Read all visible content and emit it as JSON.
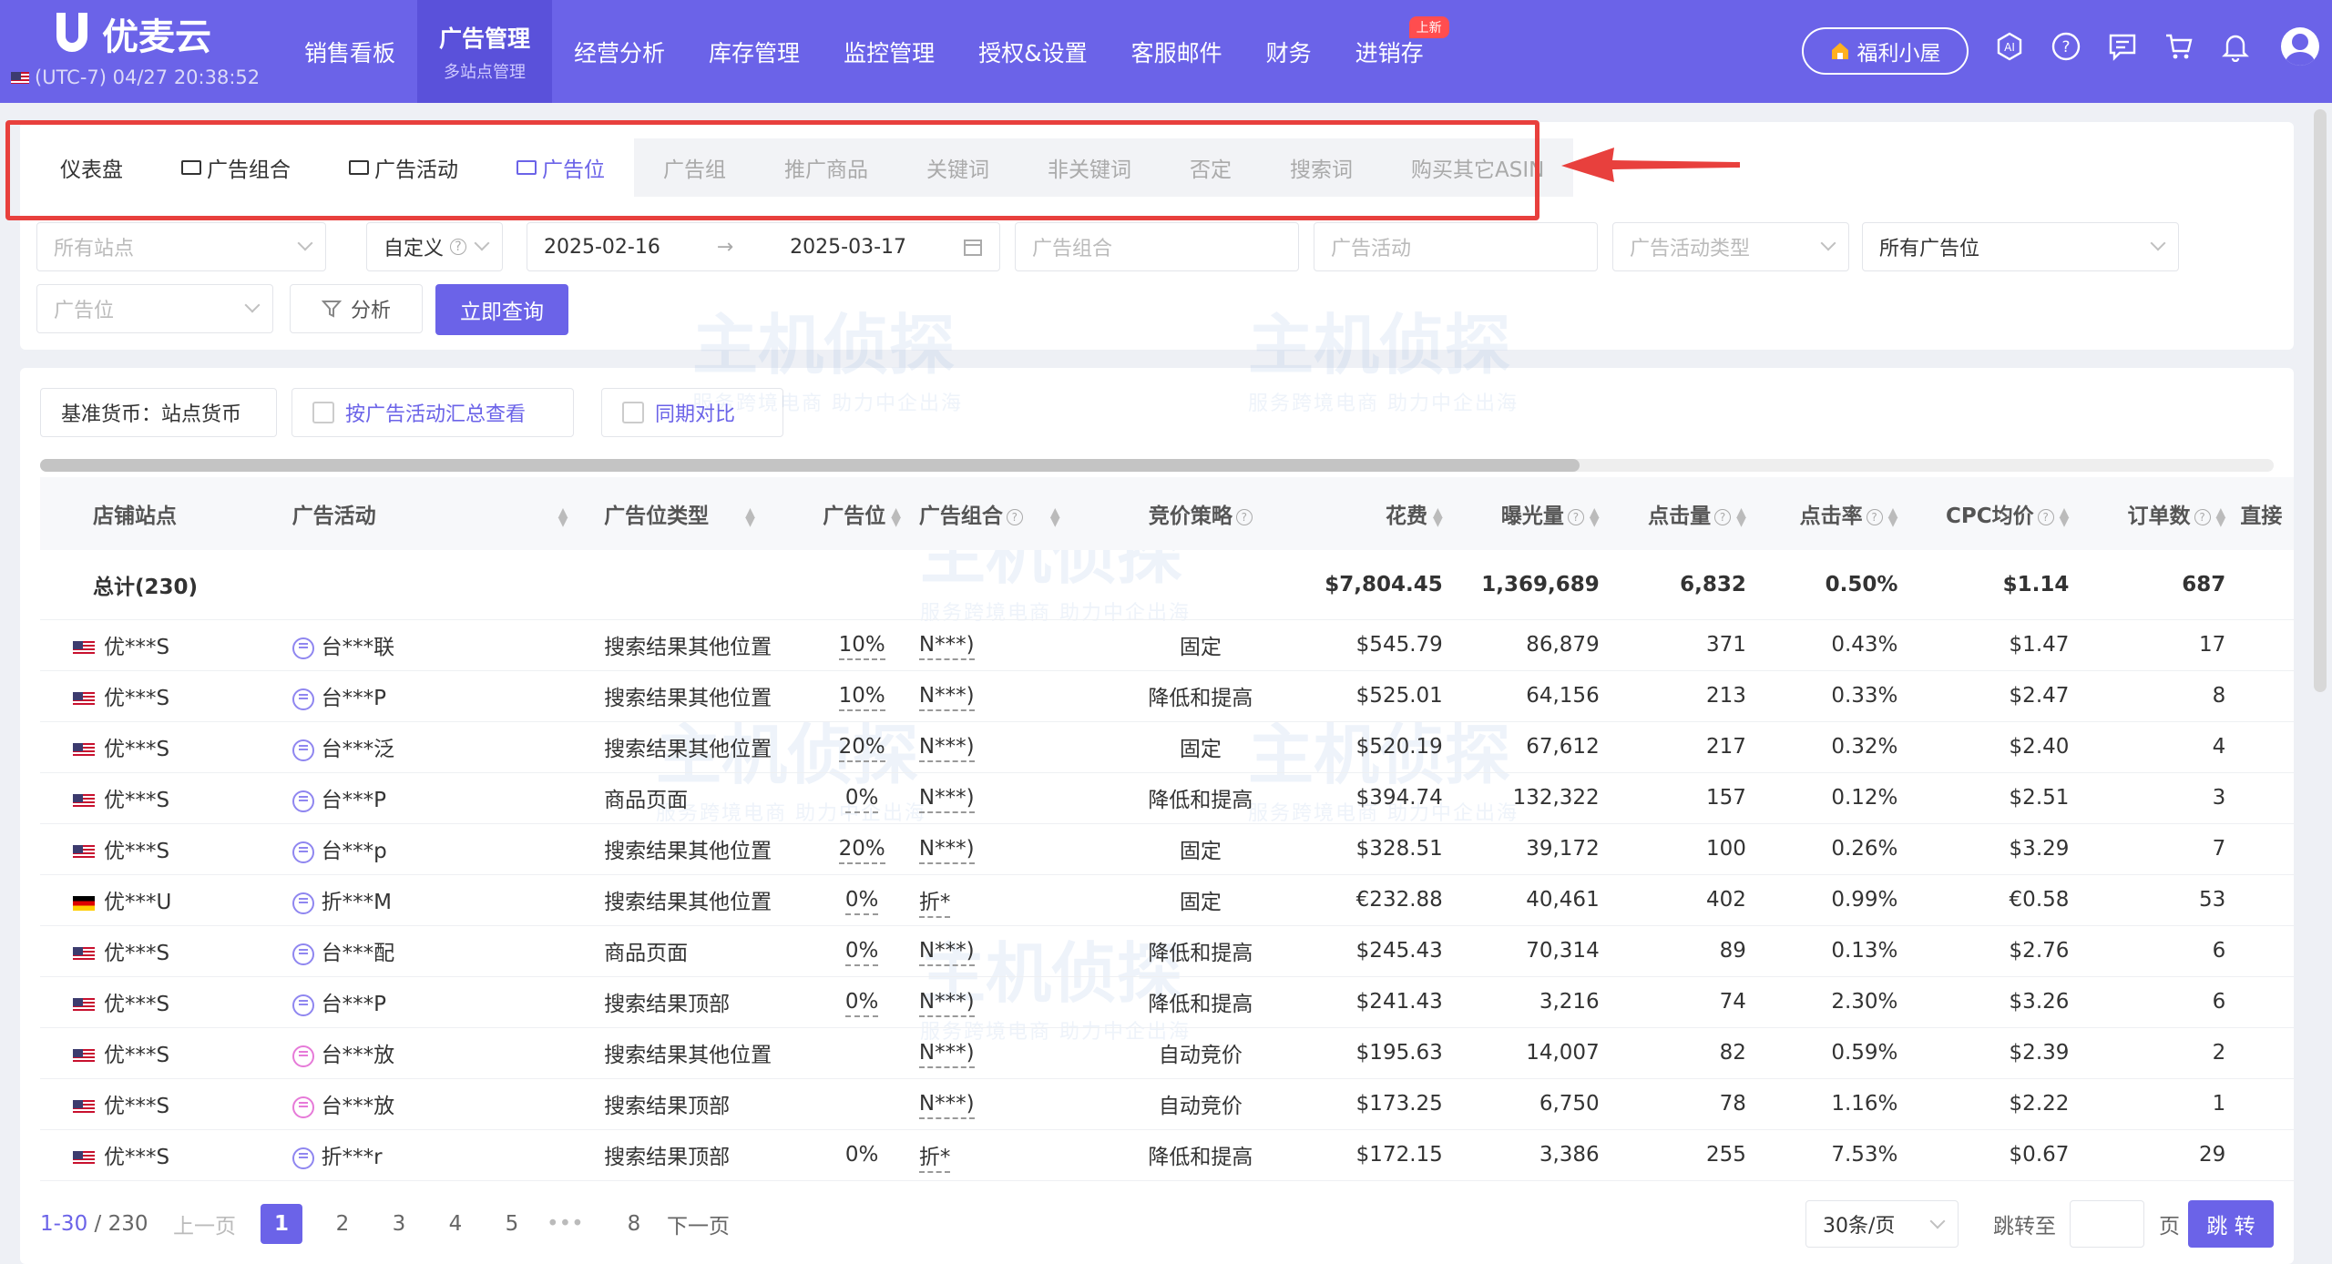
{
  "brand": {
    "name": "优麦云",
    "tz": "(UTC-7) 04/27 20:38:52"
  },
  "nav": [
    {
      "label": "销售看板",
      "sub": ""
    },
    {
      "label": "广告管理",
      "sub": "多站点管理"
    },
    {
      "label": "经营分析",
      "sub": ""
    },
    {
      "label": "库存管理",
      "sub": ""
    },
    {
      "label": "监控管理",
      "sub": ""
    },
    {
      "label": "授权&设置",
      "sub": ""
    },
    {
      "label": "客服邮件",
      "sub": ""
    },
    {
      "label": "财务",
      "sub": ""
    },
    {
      "label": "进销存",
      "sub": "",
      "badge": "上新"
    }
  ],
  "welfare": "福利小屋",
  "tabs": [
    "仪表盘",
    "广告组合",
    "广告活动",
    "广告位",
    "广告组",
    "推广商品",
    "关键词",
    "非关键词",
    "否定",
    "搜索词",
    "购买其它ASIN"
  ],
  "filters": {
    "site": "所有站点",
    "date_mode": "自定义",
    "date_start": "2025-02-16",
    "date_sep": "→",
    "date_end": "2025-03-17",
    "portfolio": "广告组合",
    "campaign": "广告活动",
    "campaign_type": "广告活动类型",
    "placement_all": "所有广告位",
    "placement": "广告位",
    "analyze": "分析",
    "query": "立即查询"
  },
  "options": {
    "currency": "基准货币：站点货币",
    "by_campaign": "按广告活动汇总查看",
    "yoy": "同期对比"
  },
  "columns": [
    "店铺站点",
    "广告活动",
    "广告位类型",
    "广告位",
    "广告组合",
    "竞价策略",
    "花费",
    "曝光量",
    "点击量",
    "点击率",
    "CPC均价",
    "订单数",
    "直接"
  ],
  "total": {
    "label": "总计(230)",
    "spend": "$7,804.45",
    "impressions": "1,369,689",
    "clicks": "6,832",
    "ctr": "0.50%",
    "cpc": "$1.14",
    "orders": "687"
  },
  "rows": [
    {
      "flag": "us",
      "shop": "优***S",
      "campaign": "台***联",
      "type": "搜索结果其他位置",
      "placement": "10%",
      "portfolio": "N***)",
      "strategy": "固定",
      "spend": "$545.79",
      "impressions": "86,879",
      "clicks": "371",
      "ctr": "0.43%",
      "cpc": "$1.47",
      "orders": "17"
    },
    {
      "flag": "us",
      "shop": "优***S",
      "campaign": "台***P",
      "type": "搜索结果其他位置",
      "placement": "10%",
      "portfolio": "N***)",
      "strategy": "降低和提高",
      "spend": "$525.01",
      "impressions": "64,156",
      "clicks": "213",
      "ctr": "0.33%",
      "cpc": "$2.47",
      "orders": "8"
    },
    {
      "flag": "us",
      "shop": "优***S",
      "campaign": "台***泛",
      "type": "搜索结果其他位置",
      "placement": "20%",
      "portfolio": "N***)",
      "strategy": "固定",
      "spend": "$520.19",
      "impressions": "67,612",
      "clicks": "217",
      "ctr": "0.32%",
      "cpc": "$2.40",
      "orders": "4"
    },
    {
      "flag": "us",
      "shop": "优***S",
      "campaign": "台***P",
      "type": "商品页面",
      "placement": "0%",
      "portfolio": "N***)",
      "strategy": "降低和提高",
      "spend": "$394.74",
      "impressions": "132,322",
      "clicks": "157",
      "ctr": "0.12%",
      "cpc": "$2.51",
      "orders": "3"
    },
    {
      "flag": "us",
      "shop": "优***S",
      "campaign": "台***p",
      "type": "搜索结果其他位置",
      "placement": "20%",
      "portfolio": "N***)",
      "strategy": "固定",
      "spend": "$328.51",
      "impressions": "39,172",
      "clicks": "100",
      "ctr": "0.26%",
      "cpc": "$3.29",
      "orders": "7"
    },
    {
      "flag": "de",
      "shop": "优***U",
      "campaign": "折***M",
      "type": "搜索结果其他位置",
      "placement": "0%",
      "portfolio": "折*",
      "strategy": "固定",
      "spend": "€232.88",
      "impressions": "40,461",
      "clicks": "402",
      "ctr": "0.99%",
      "cpc": "€0.58",
      "orders": "53"
    },
    {
      "flag": "us",
      "shop": "优***S",
      "campaign": "台***配",
      "type": "商品页面",
      "placement": "0%",
      "portfolio": "N***)",
      "strategy": "降低和提高",
      "spend": "$245.43",
      "impressions": "70,314",
      "clicks": "89",
      "ctr": "0.13%",
      "cpc": "$2.76",
      "orders": "6"
    },
    {
      "flag": "us",
      "shop": "优***S",
      "campaign": "台***P",
      "type": "搜索结果顶部",
      "placement": "0%",
      "portfolio": "N***)",
      "strategy": "降低和提高",
      "spend": "$241.43",
      "impressions": "3,216",
      "clicks": "74",
      "ctr": "2.30%",
      "cpc": "$3.26",
      "orders": "6"
    },
    {
      "flag": "us",
      "shop": "优***S",
      "campaign": "台***放",
      "type": "搜索结果其他位置",
      "placement": "",
      "portfolio": "N***)",
      "strategy": "自动竞价",
      "spend": "$195.63",
      "impressions": "14,007",
      "clicks": "82",
      "ctr": "0.59%",
      "cpc": "$2.39",
      "orders": "2",
      "pink": true
    },
    {
      "flag": "us",
      "shop": "优***S",
      "campaign": "台***放",
      "type": "搜索结果顶部",
      "placement": "",
      "portfolio": "N***)",
      "strategy": "自动竞价",
      "spend": "$173.25",
      "impressions": "6,750",
      "clicks": "78",
      "ctr": "1.16%",
      "cpc": "$2.22",
      "orders": "1",
      "pink": true
    },
    {
      "flag": "us",
      "shop": "优***S",
      "campaign": "折***r",
      "type": "搜索结果顶部",
      "placement": "0%",
      "portfolio": "折*",
      "strategy": "降低和提高",
      "spend": "$172.15",
      "impressions": "3,386",
      "clicks": "255",
      "ctr": "7.53%",
      "cpc": "$0.67",
      "orders": "29"
    }
  ],
  "pager": {
    "range": "1-30",
    "total": "/ 230",
    "prev": "上一页",
    "pages": [
      "1",
      "2",
      "3",
      "4",
      "5",
      "•••",
      "8"
    ],
    "next": "下一页",
    "size": "30条/页",
    "goto": "跳转至",
    "page_unit": "页",
    "jump": "跳 转"
  },
  "watermark": {
    "text": "主机侦探",
    "sub": "服务跨境电商 助力中企出海"
  }
}
